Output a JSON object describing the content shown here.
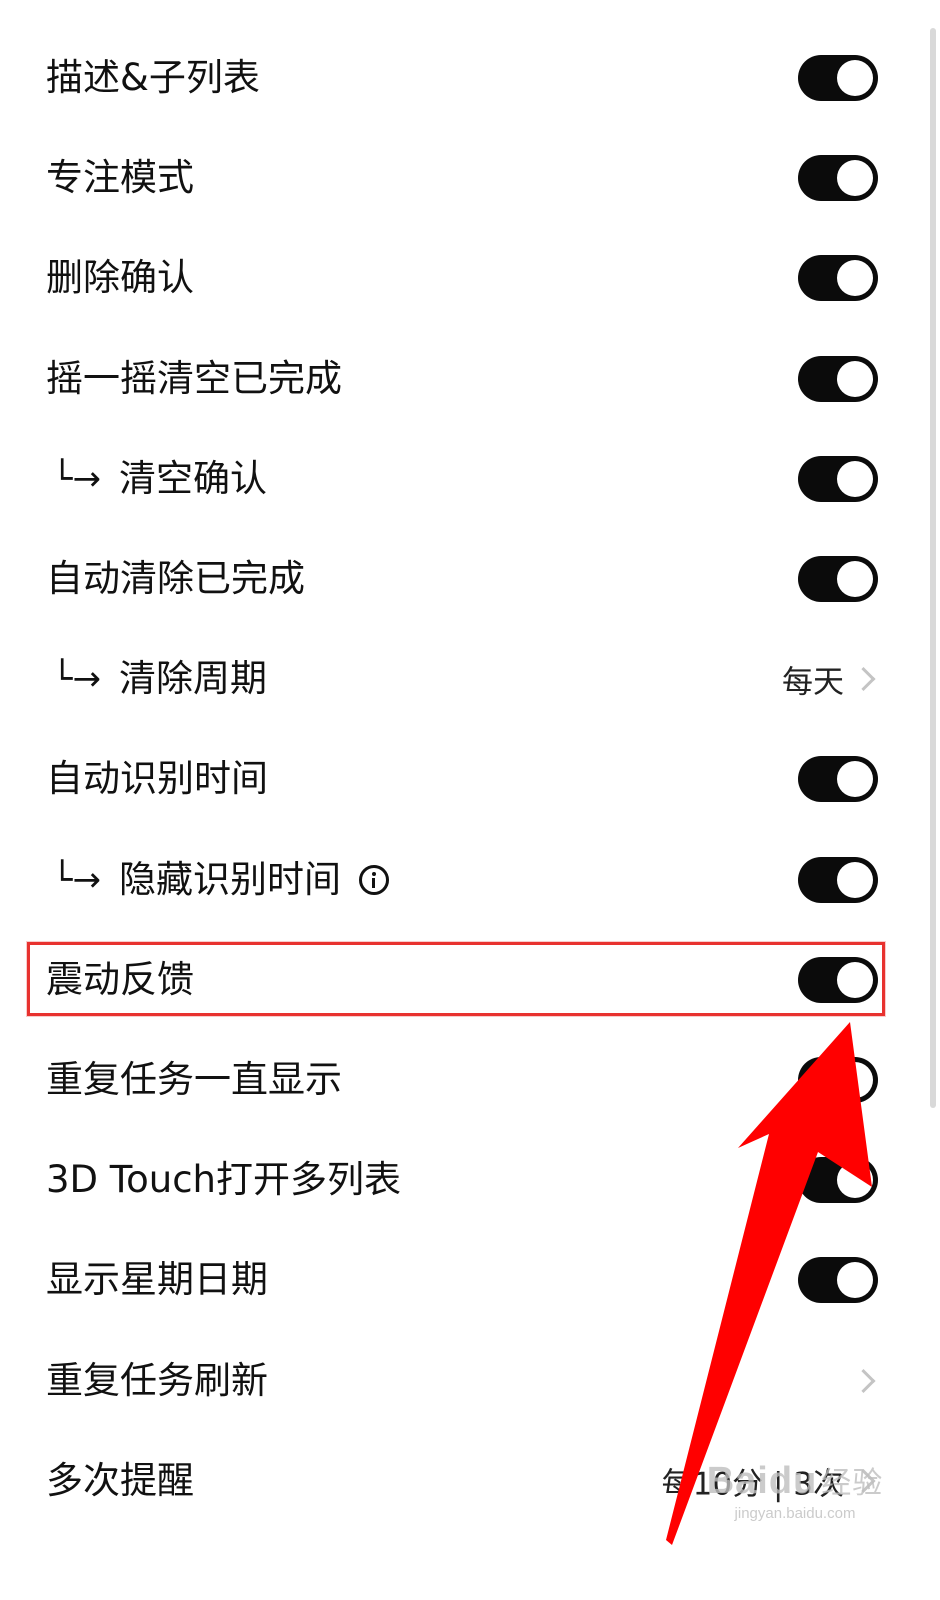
{
  "settings": {
    "rows": [
      {
        "label": "描述&子列表",
        "control": "toggle",
        "on": true
      },
      {
        "label": "专注模式",
        "control": "toggle",
        "on": true
      },
      {
        "label": "删除确认",
        "control": "toggle",
        "on": true
      },
      {
        "label": "摇一摇清空已完成",
        "control": "toggle",
        "on": true
      },
      {
        "label": "清空确认",
        "control": "toggle",
        "on": true,
        "sub": true
      },
      {
        "label": "自动清除已完成",
        "control": "toggle",
        "on": true
      },
      {
        "label": "清除周期",
        "control": "value",
        "value": "每天",
        "sub": true
      },
      {
        "label": "自动识别时间",
        "control": "toggle",
        "on": true
      },
      {
        "label": "隐藏识别时间",
        "control": "toggle",
        "on": true,
        "sub": true,
        "info": true
      },
      {
        "label": "震动反馈",
        "control": "toggle",
        "on": true,
        "highlighted": true
      },
      {
        "label": "重复任务一直显示",
        "control": "toggle",
        "on": true
      },
      {
        "label": "3D Touch打开多列表",
        "control": "toggle",
        "on": true
      },
      {
        "label": "显示星期日期",
        "control": "toggle",
        "on": true
      },
      {
        "label": "重复任务刷新",
        "control": "chevron"
      },
      {
        "label": "多次提醒",
        "control": "value",
        "value": "每10分 | 3次"
      }
    ],
    "sub_prefix": "└→"
  },
  "annotation": {
    "highlight_color": "#e8322f",
    "arrow_color": "#ff0000"
  },
  "watermark": {
    "logo_text": "Baidu",
    "logo_suffix": "经验",
    "url": "jingyan.baidu.com"
  },
  "icons": {
    "info": "info-circle-icon",
    "chevron": "chevron-right-icon",
    "sub_arrow": "sub-item-arrow-icon"
  }
}
